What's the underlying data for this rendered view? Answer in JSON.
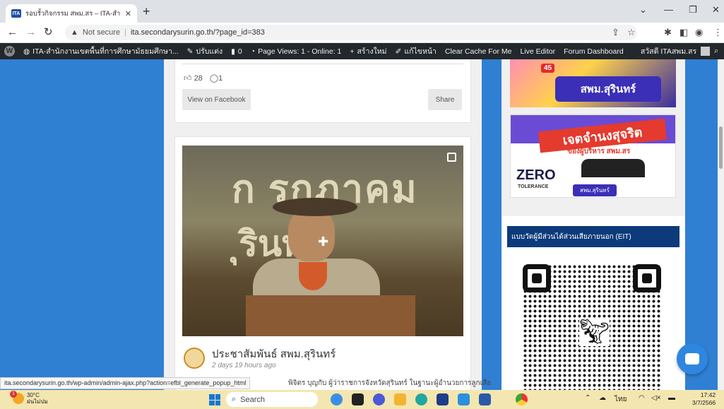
{
  "browser": {
    "tab_title": "รอบรั้วกิจกรรม สพม.สร – ITA-สำนัก",
    "tab_icon": "ITA",
    "url_warning": "Not secure",
    "url": "ita.secondarysurin.go.th/?page_id=383"
  },
  "wpbar": {
    "site_name": "ITA-สำนักงานเขตพื้นที่การศึกษามัธยมศึกษา...",
    "customize": "ปรับแต่ง",
    "comments_count": "0",
    "page_views": "Page Views: 1 - Online: 1",
    "new": "สร้างใหม่",
    "edit": "แก้ไขหน้า",
    "clear_cache": "Clear Cache For Me",
    "live_editor": "Live Editor",
    "forum": "Forum Dashboard",
    "greeting": "สวัสดี ITAสพม.สร"
  },
  "post1": {
    "likes": "28",
    "comments": "1",
    "view_button": "View on Facebook",
    "share_button": "Share"
  },
  "post2": {
    "photo_text_1": "ก รกฎาคม",
    "photo_text_2": "ุรินทร์",
    "page_name": "ประชาสัมพันธ์ สพม.สุรินทร์",
    "posted": "2 days 19 hours ago",
    "text": "พิจิตร บุญกับ ผู้ว่าราชการจังหวัดสุรินทร์ ในฐานะผู้อำนวยการลูกเสือ"
  },
  "sidebar": {
    "badge": "45",
    "banner1_label": "สพม.สุรินทร์",
    "banner2_title": "เจตจำนงสุจริต",
    "banner2_sub": "ของผู้บริหาร สพม.สร",
    "banner2_zero": "ZERO",
    "banner2_tolerance": "TOLERANCE",
    "banner2_pill": "สพม.สุรินทร์",
    "eit_title": "แบบวัดผู้มีส่วนได้ส่วนเสียภายนอก (EIT)"
  },
  "status_url": "ita.secondarysurin.go.th/wp-admin/admin-ajax.php?action=efbl_generate_popup_html",
  "taskbar": {
    "weather_temp": "30°C",
    "weather_desc": "ฝนไม่ปม",
    "weather_alert": "1",
    "search": "Search",
    "lang": "ไทย",
    "time": "17:42",
    "date": "3/7/2566"
  },
  "colors": {
    "page_bg": "#2f7fd3",
    "wpbar_bg": "#23282d",
    "eit_header": "#0d3a7a",
    "taskbar": "#f3e6b0"
  }
}
